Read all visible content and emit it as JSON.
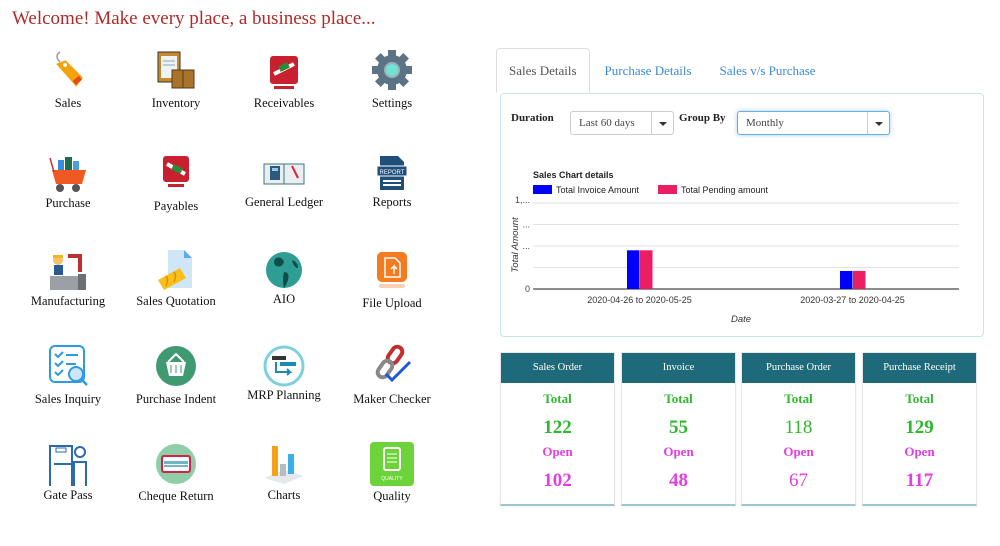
{
  "header": {
    "welcome": "Welcome! Make every place, a business place..."
  },
  "modules": [
    {
      "label": "Sales",
      "icon": "price-tag-icon"
    },
    {
      "label": "Inventory",
      "icon": "clipboard-boxes-icon"
    },
    {
      "label": "Receivables",
      "icon": "receivable-money-hand-icon"
    },
    {
      "label": "Settings",
      "icon": "gear-icon"
    },
    {
      "label": "Purchase",
      "icon": "shopping-cart-icon"
    },
    {
      "label": "Payables",
      "icon": "payable-money-hand-icon"
    },
    {
      "label": "General Ledger",
      "icon": "ledger-book-calculator-icon"
    },
    {
      "label": "Reports",
      "icon": "report-document-icon"
    },
    {
      "label": "Manufacturing",
      "icon": "factory-worker-robot-arm-icon"
    },
    {
      "label": "Sales Quotation",
      "icon": "quotation-document-icon"
    },
    {
      "label": "AIO",
      "icon": "globe-icon"
    },
    {
      "label": "File Upload",
      "icon": "upload-file-icon"
    },
    {
      "label": "Sales Inquiry",
      "icon": "checklist-search-icon"
    },
    {
      "label": "Purchase Indent",
      "icon": "basket-icon"
    },
    {
      "label": "MRP Planning",
      "icon": "mrp-transfer-icon"
    },
    {
      "label": "Maker Checker",
      "icon": "chain-check-icon"
    },
    {
      "label": "Gate Pass",
      "icon": "security-gate-icon"
    },
    {
      "label": "Cheque Return",
      "icon": "cheque-card-icon"
    },
    {
      "label": "Charts",
      "icon": "bar-chart-3d-icon"
    },
    {
      "label": "Quality",
      "icon": "quality-clipboard-icon"
    }
  ],
  "tabs": [
    {
      "label": "Sales Details",
      "active": true
    },
    {
      "label": "Purchase Details",
      "active": false
    },
    {
      "label": "Sales v/s Purchase",
      "active": false
    }
  ],
  "filters": {
    "duration_label": "Duration",
    "duration_value": "Last 60 days",
    "groupby_label": "Group By",
    "groupby_value": "Monthly"
  },
  "chart_data": {
    "type": "bar",
    "title": "Sales Chart details",
    "xlabel": "Date",
    "ylabel": "Total Amount",
    "categories": [
      "2020-04-26 to 2020-05-25",
      "2020-03-27 to 2020-04-25"
    ],
    "series": [
      {
        "name": "Total Invoice Amount",
        "color": "#0000ff",
        "values": [
          0.45,
          0.21
        ]
      },
      {
        "name": "Total Pending amount",
        "color": "#e91e63",
        "values": [
          0.45,
          0.21
        ]
      }
    ],
    "value_units": "fraction of top y-axis tick (tick labels truncated)",
    "ylim": [
      0,
      1
    ],
    "y_ticks": [
      {
        "value": 0,
        "label": "0"
      },
      {
        "value": 0.25,
        "label": ""
      },
      {
        "value": 0.5,
        "label": "..."
      },
      {
        "value": 0.75,
        "label": "..."
      },
      {
        "value": 1,
        "label": "1,..."
      }
    ],
    "grid": true,
    "legend": "top-left"
  },
  "cards": [
    {
      "title": "Sales Order",
      "total_label": "Total",
      "total": "122",
      "open_label": "Open",
      "open": "102"
    },
    {
      "title": "Invoice",
      "total_label": "Total",
      "total": "55",
      "open_label": "Open",
      "open": "48"
    },
    {
      "title": "Purchase Order",
      "total_label": "Total",
      "total": "118",
      "open_label": "Open",
      "open": "67"
    },
    {
      "title": "Purchase Receipt",
      "total_label": "Total",
      "total": "129",
      "open_label": "Open",
      "open": "117"
    }
  ],
  "colors": {
    "welcome": "#b02a2a",
    "tab_link": "#3a8bd0",
    "card_header": "#1f6a7a",
    "total_green": "#2eb82e",
    "open_magenta": "#e23ee2"
  }
}
